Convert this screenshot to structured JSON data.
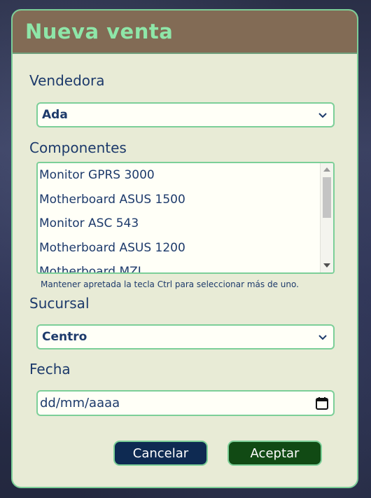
{
  "modal": {
    "title": "Nueva venta"
  },
  "form": {
    "vendedora": {
      "label": "Vendedora",
      "selected": "Ada"
    },
    "componentes": {
      "label": "Componentes",
      "options": [
        "Monitor GPRS 3000",
        "Motherboard ASUS 1500",
        "Monitor ASC 543",
        "Motherboard ASUS 1200",
        "Motherboard MZI"
      ],
      "hint": "Mantener apretada la tecla Ctrl para seleccionar más de uno."
    },
    "sucursal": {
      "label": "Sucursal",
      "selected": "Centro"
    },
    "fecha": {
      "label": "Fecha",
      "placeholder": "dd/mm/aaaa"
    }
  },
  "buttons": {
    "cancel": "Cancelar",
    "accept": "Aceptar"
  },
  "icons": {
    "select_chevron": "chevron-down-icon",
    "calendar": "calendar-icon"
  },
  "colors": {
    "header_bg": "#826b55",
    "title": "#8ee6a8",
    "panel_bg": "#e8ebd6",
    "border": "#7ccf98",
    "text": "#1d3a6b",
    "cancel_bg": "#0e2a52",
    "accept_bg": "#114a14"
  }
}
